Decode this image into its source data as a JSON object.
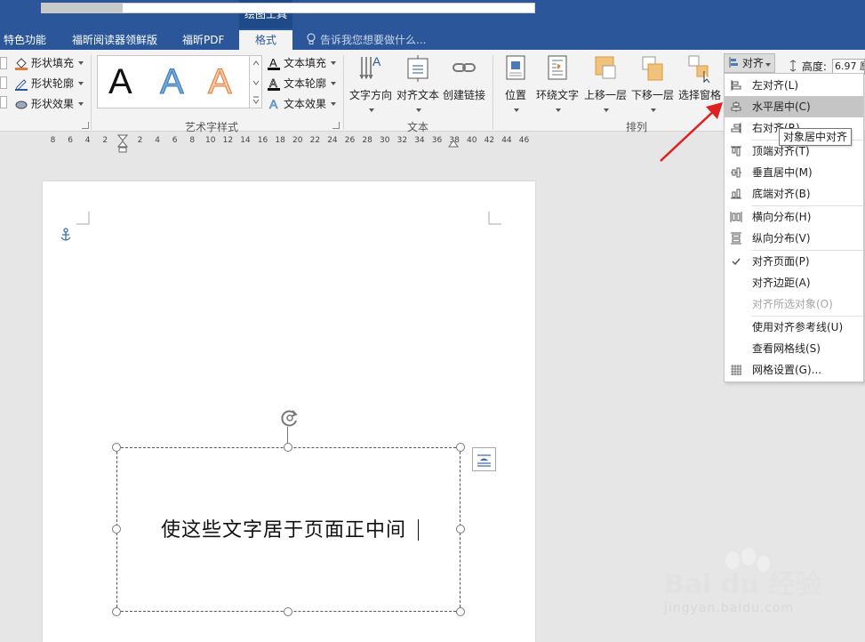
{
  "tabs": {
    "context_group": "绘图工具",
    "items": [
      {
        "label": "特色功能"
      },
      {
        "label": "福昕阅读器领鲜版"
      },
      {
        "label": "福昕PDF"
      },
      {
        "label": "格式"
      }
    ],
    "tell_me": "告诉我您想要做什么..."
  },
  "ribbon": {
    "shape_styles": {
      "fill": "形状填充",
      "outline": "形状轮廓",
      "effects": "形状效果"
    },
    "wordart": {
      "letters": [
        "A",
        "A",
        "A"
      ],
      "text_fill": "文本填充",
      "text_outline": "文本轮廓",
      "text_effects": "文本效果",
      "group_label": "艺术字样式"
    },
    "text_group": {
      "direction": "文字方向",
      "align_text": "对齐文本",
      "create_link": "创建链接",
      "group_label": "文本"
    },
    "arrange": {
      "position": "位置",
      "wrap_text": "环绕文字",
      "bring_forward": "上移一层",
      "send_backward": "下移一层",
      "selection_pane": "选择窗格",
      "group_label": "排列",
      "align": "对齐"
    },
    "size": {
      "height_label": "高度:",
      "height_value": "6.97 厘"
    }
  },
  "ruler": {
    "left_numbers": [
      "8",
      "6",
      "4",
      "2"
    ],
    "right_numbers": [
      "2",
      "4",
      "6",
      "8",
      "10",
      "12",
      "14",
      "16",
      "18",
      "20",
      "22",
      "24",
      "26",
      "28",
      "30",
      "32",
      "34",
      "36",
      "38",
      "40",
      "42",
      "44",
      "46"
    ]
  },
  "document": {
    "textbox_text": "使这些文字居于页面正中间"
  },
  "align_menu": {
    "items": [
      {
        "label": "左对齐(L)",
        "icon": "align-left-icon"
      },
      {
        "label": "水平居中(C)",
        "icon": "align-center-icon"
      },
      {
        "label": "右对齐(R)",
        "icon": "align-right-icon"
      },
      {
        "label": "顶端对齐(T)",
        "icon": "align-top-icon"
      },
      {
        "label": "垂直居中(M)",
        "icon": "align-middle-icon"
      },
      {
        "label": "底端对齐(B)",
        "icon": "align-bottom-icon"
      },
      {
        "label": "横向分布(H)",
        "icon": "distribute-horizontal-icon"
      },
      {
        "label": "纵向分布(V)",
        "icon": "distribute-vertical-icon"
      },
      {
        "label": "对齐页面(P)",
        "icon": "checkmark-icon"
      },
      {
        "label": "对齐边距(A)",
        "icon": ""
      },
      {
        "label": "对齐所选对象(O)",
        "icon": ""
      },
      {
        "label": "使用对齐参考线(U)",
        "icon": ""
      },
      {
        "label": "查看网格线(S)",
        "icon": ""
      },
      {
        "label": "网格设置(G)...",
        "icon": "grid-icon"
      }
    ],
    "tooltip": "对象居中对齐"
  },
  "watermark": {
    "brand": "Bai du 经验",
    "url": "jingyan.baidu.com"
  },
  "colors": {
    "title_bar": "#2b579a",
    "ribbon_bg": "#f3f3f3",
    "menu_hover": "#c5c5c5",
    "arrow": "#e02020"
  }
}
